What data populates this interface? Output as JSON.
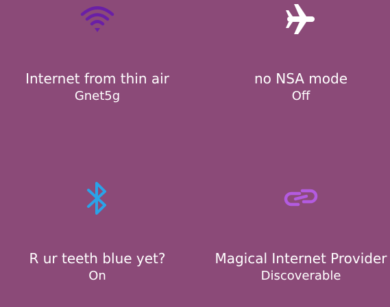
{
  "colors": {
    "background": "#8b4a78",
    "text": "#ffffff",
    "wifi_icon": "#6a1fa6",
    "airplane_icon": "#ffffff",
    "bluetooth_icon": "#2aa3e8",
    "link_icon": "#b35be0"
  },
  "tiles": [
    {
      "icon": "wifi-icon",
      "title": "Internet from thin air",
      "status": "Gnet5g"
    },
    {
      "icon": "airplane-icon",
      "title": "no NSA mode",
      "status": "Off"
    },
    {
      "icon": "bluetooth-icon",
      "title": "R ur teeth blue yet?",
      "status": "On"
    },
    {
      "icon": "link-icon",
      "title": "Magical Internet Provider",
      "status": "Discoverable"
    }
  ]
}
